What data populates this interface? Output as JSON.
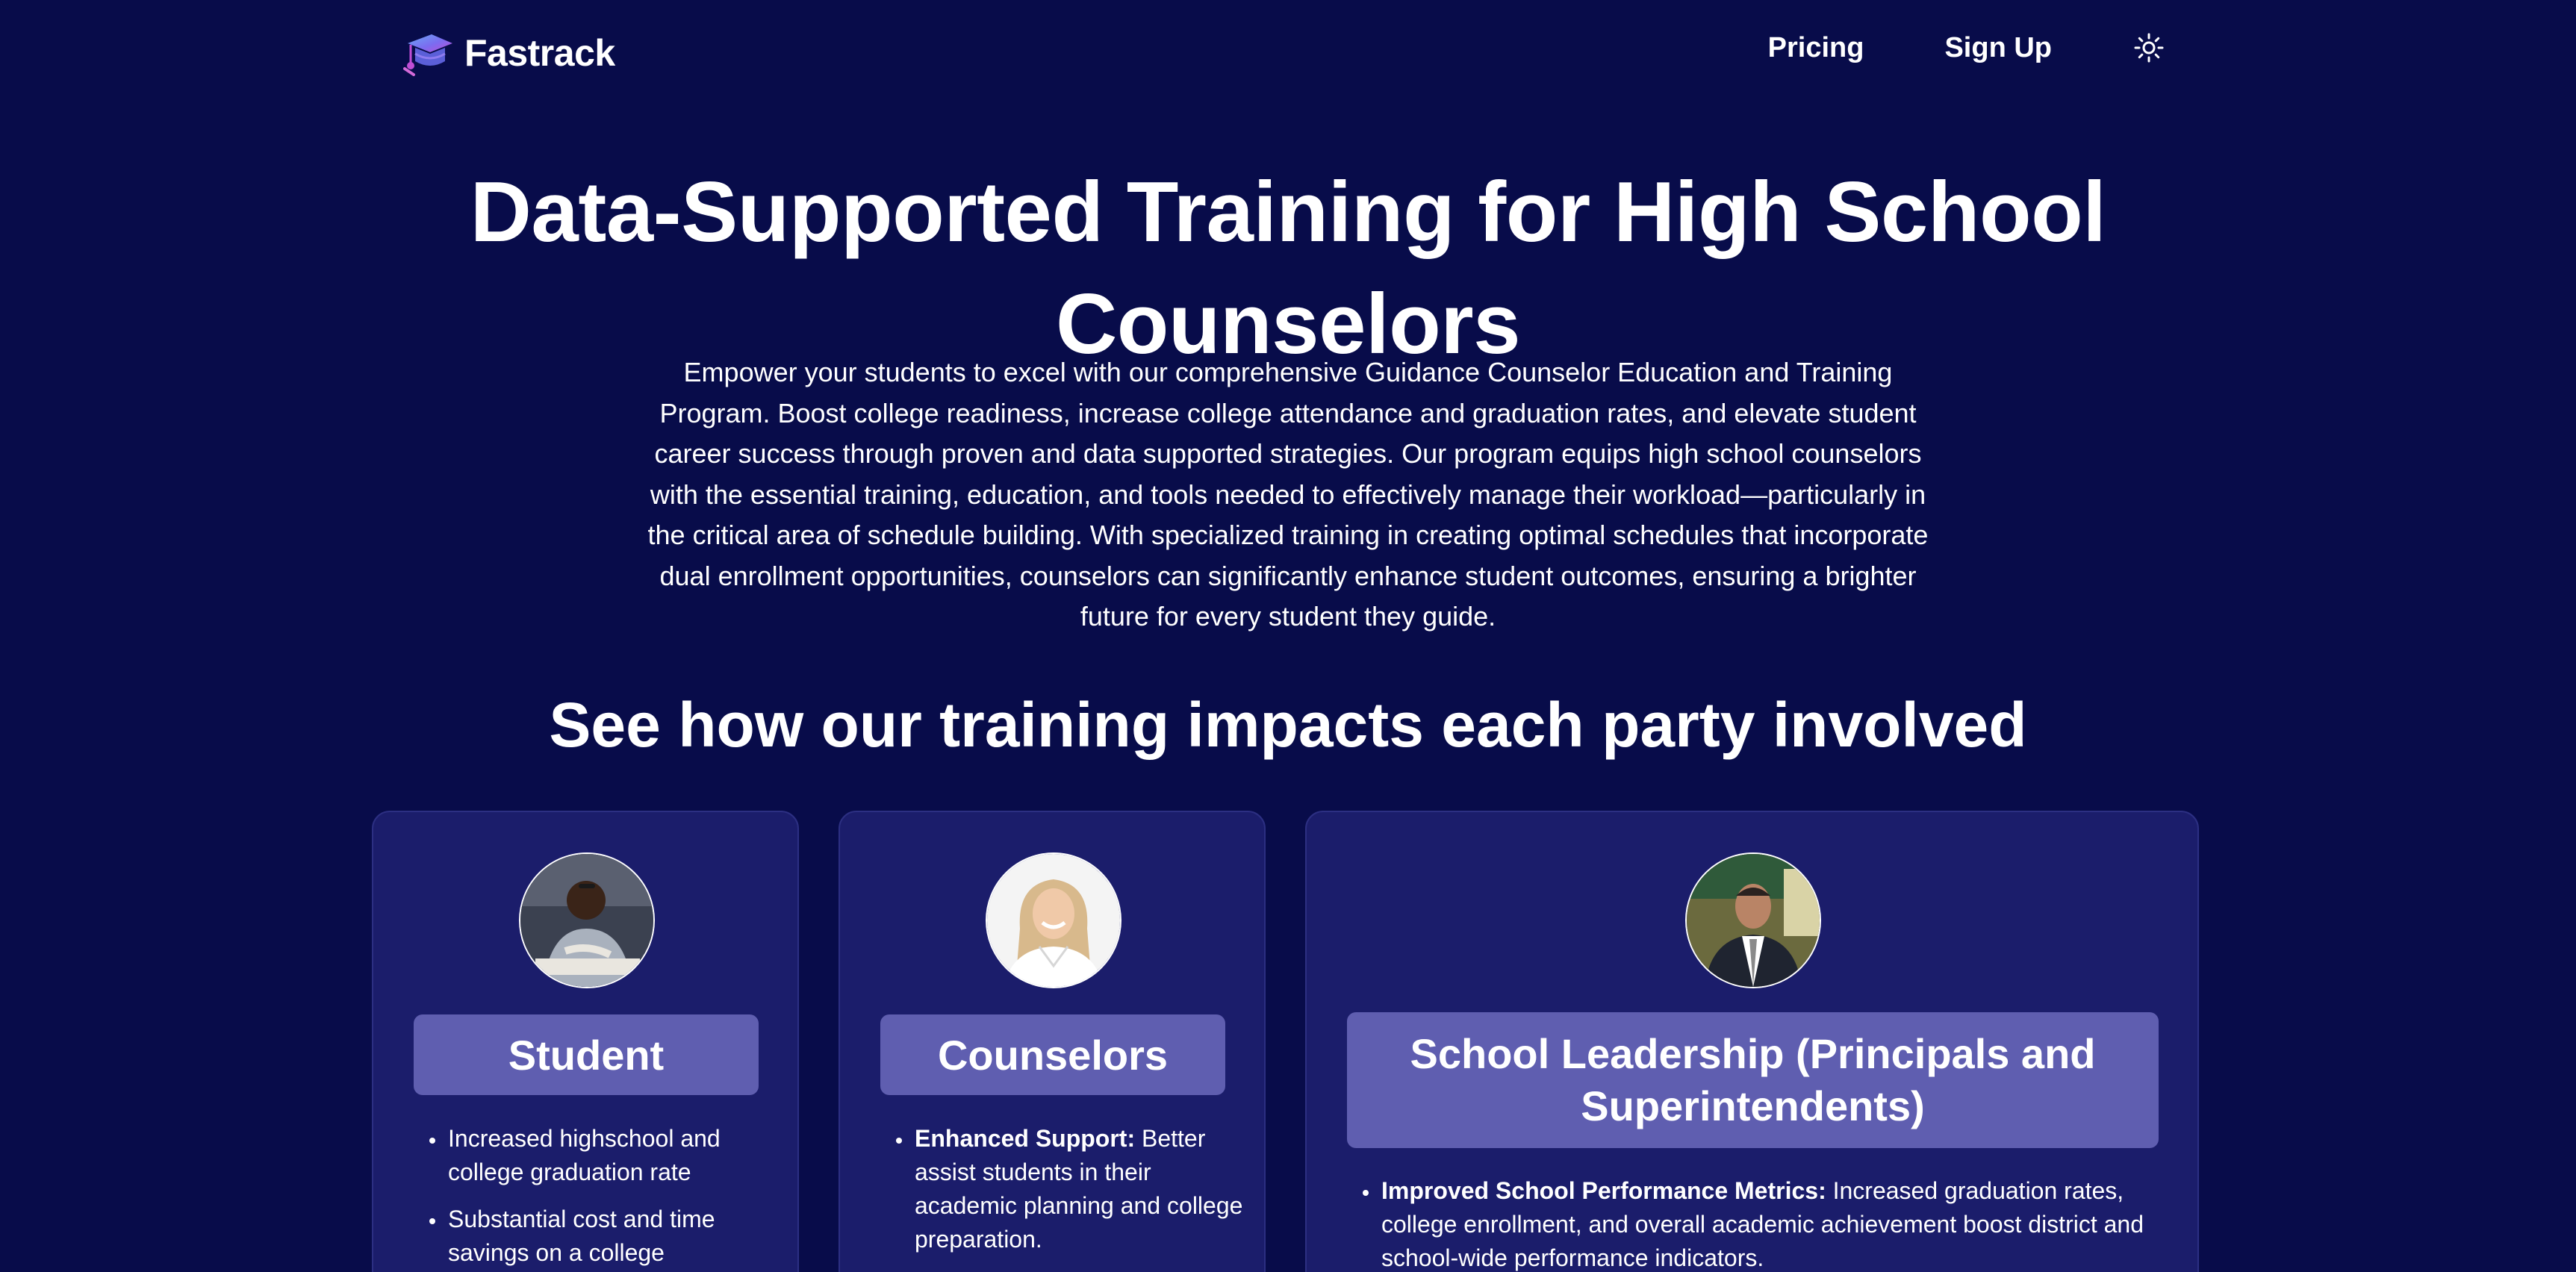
{
  "header": {
    "brand": "Fastrack",
    "nav": {
      "pricing": "Pricing",
      "signup": "Sign Up"
    }
  },
  "hero": {
    "title": "Data-Supported Training for High School Counselors",
    "body": "Empower your students to excel with our comprehensive Guidance Counselor Education and Training Program. Boost college readiness, increase college attendance and graduation rates, and elevate student career success through proven and data supported strategies. Our program equips high school counselors with the essential training, education, and tools needed to effectively manage their workload—particularly in the critical area of schedule building. With specialized training in creating optimal schedules that incorporate dual enrollment opportunities, counselors can significantly enhance student outcomes, ensuring a brighter future for every student they guide."
  },
  "impact": {
    "title": "See how our training impacts each party involved",
    "cards": [
      {
        "label": "Student",
        "items": [
          {
            "bold": "",
            "text": "Increased highschool and college graduation rate"
          },
          {
            "bold": "",
            "text": "Substantial cost and time savings on a college"
          }
        ]
      },
      {
        "label": "Counselors",
        "items": [
          {
            "bold": "Enhanced Support:",
            "text": " Better assist students in their academic planning and college preparation."
          }
        ]
      },
      {
        "label": "School Leadership (Principals and Superintendents)",
        "items": [
          {
            "bold": "Improved School Performance Metrics:",
            "text": " Increased graduation rates, college enrollment, and overall academic achievement boost district and school-wide performance indicators."
          }
        ]
      }
    ]
  },
  "colors": {
    "background": "#080c4a",
    "card": "#1b1d6b",
    "label": "#5f5eb0",
    "logo_gradient": [
      "#5b8def",
      "#c04ed6"
    ]
  },
  "icons": {
    "logo": "graduation-cap-icon",
    "theme": "sun-icon"
  }
}
